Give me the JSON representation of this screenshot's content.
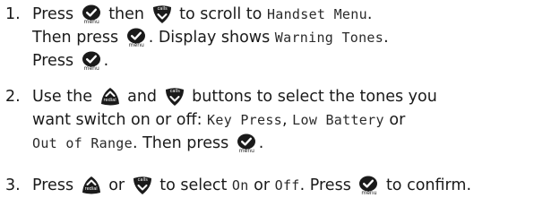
{
  "steps": [
    {
      "number": "1.",
      "lines": [
        [
          {
            "t": "text",
            "v": "Press "
          },
          {
            "t": "btn",
            "kind": "menu"
          },
          {
            "t": "text",
            "v": " then "
          },
          {
            "t": "btn",
            "kind": "calls"
          },
          {
            "t": "text",
            "v": " to scroll to "
          },
          {
            "t": "lcd",
            "v": "Handset Menu"
          },
          {
            "t": "text",
            "v": "."
          }
        ],
        [
          {
            "t": "text",
            "v": "Then press "
          },
          {
            "t": "btn",
            "kind": "menu"
          },
          {
            "t": "text",
            "v": ". Display shows "
          },
          {
            "t": "lcd",
            "v": "Warning Tones"
          },
          {
            "t": "text",
            "v": "."
          }
        ],
        [
          {
            "t": "text",
            "v": "Press "
          },
          {
            "t": "btn",
            "kind": "menu"
          },
          {
            "t": "text",
            "v": "."
          }
        ]
      ]
    },
    {
      "number": "2.",
      "lines": [
        [
          {
            "t": "text",
            "v": "Use the "
          },
          {
            "t": "btn",
            "kind": "redial"
          },
          {
            "t": "text",
            "v": " and "
          },
          {
            "t": "btn",
            "kind": "calls"
          },
          {
            "t": "text",
            "v": " buttons to select the tones you"
          }
        ],
        [
          {
            "t": "text",
            "v": "want switch on or off: "
          },
          {
            "t": "lcd",
            "v": "Key Press"
          },
          {
            "t": "text",
            "v": ", "
          },
          {
            "t": "lcd",
            "v": "Low Battery"
          },
          {
            "t": "text",
            "v": " or"
          }
        ],
        [
          {
            "t": "lcd",
            "v": "Out of Range"
          },
          {
            "t": "text",
            "v": ". Then press "
          },
          {
            "t": "btn",
            "kind": "menu"
          },
          {
            "t": "text",
            "v": "."
          }
        ]
      ]
    },
    {
      "number": "3.",
      "lines": [
        [
          {
            "t": "text",
            "v": "Press "
          },
          {
            "t": "btn",
            "kind": "redial"
          },
          {
            "t": "text",
            "v": " or "
          },
          {
            "t": "btn",
            "kind": "calls"
          },
          {
            "t": "text",
            "v": " to select "
          },
          {
            "t": "lcd",
            "v": "On"
          },
          {
            "t": "text",
            "v": " or "
          },
          {
            "t": "lcd",
            "v": "Off"
          },
          {
            "t": "text",
            "v": ". Press "
          },
          {
            "t": "btn",
            "kind": "menu"
          },
          {
            "t": "text",
            "v": " to confirm."
          }
        ]
      ]
    }
  ],
  "buttons": {
    "menu": {
      "icon": "menu-check-button-icon",
      "label": "menu"
    },
    "calls": {
      "icon": "calls-down-button-icon",
      "label": "calls"
    },
    "redial": {
      "icon": "redial-up-button-icon",
      "label": "redial"
    }
  }
}
